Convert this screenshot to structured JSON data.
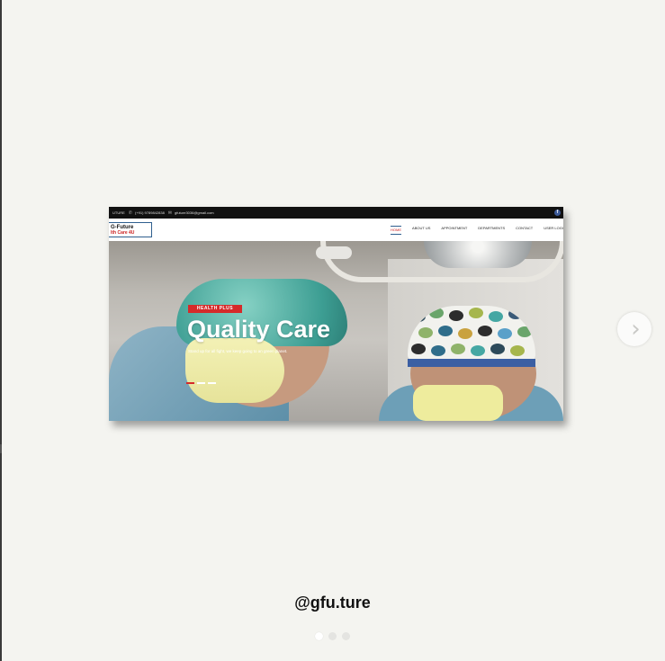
{
  "handle": "@gfu.ture",
  "carousel": {
    "current_slide": 1,
    "total_slides": 3,
    "next_icon": "chevron-right-icon"
  },
  "website": {
    "topbar": {
      "brand": "UTURE",
      "phone": "(+91) 9789842838",
      "email": "gfuture3036@gmail.com",
      "phone_icon": "phone-icon",
      "email_icon": "mail-icon",
      "social_icon": "facebook-icon",
      "social_glyph": "f"
    },
    "logo": {
      "line1": "G-Future",
      "line2": "lth Care 4U"
    },
    "nav": [
      {
        "label": "HOME",
        "active": true
      },
      {
        "label": "ABOUT US",
        "active": false
      },
      {
        "label": "APPOINTMENT",
        "active": false
      },
      {
        "label": "DEPARTMENTS",
        "active": false
      },
      {
        "label": "CONTACT",
        "active": false
      },
      {
        "label": "USER LOGI",
        "active": false
      }
    ],
    "hero": {
      "badge": "HEALTH PLUS",
      "headline": "Quality Care",
      "subline": "Stand up for all fight, we keep going to an green planet.",
      "slider_total": 3,
      "slider_current": 1
    },
    "colors": {
      "accent": "#d52a2a",
      "logo_border": "#2f5f8e",
      "topbar": "#111111"
    }
  }
}
